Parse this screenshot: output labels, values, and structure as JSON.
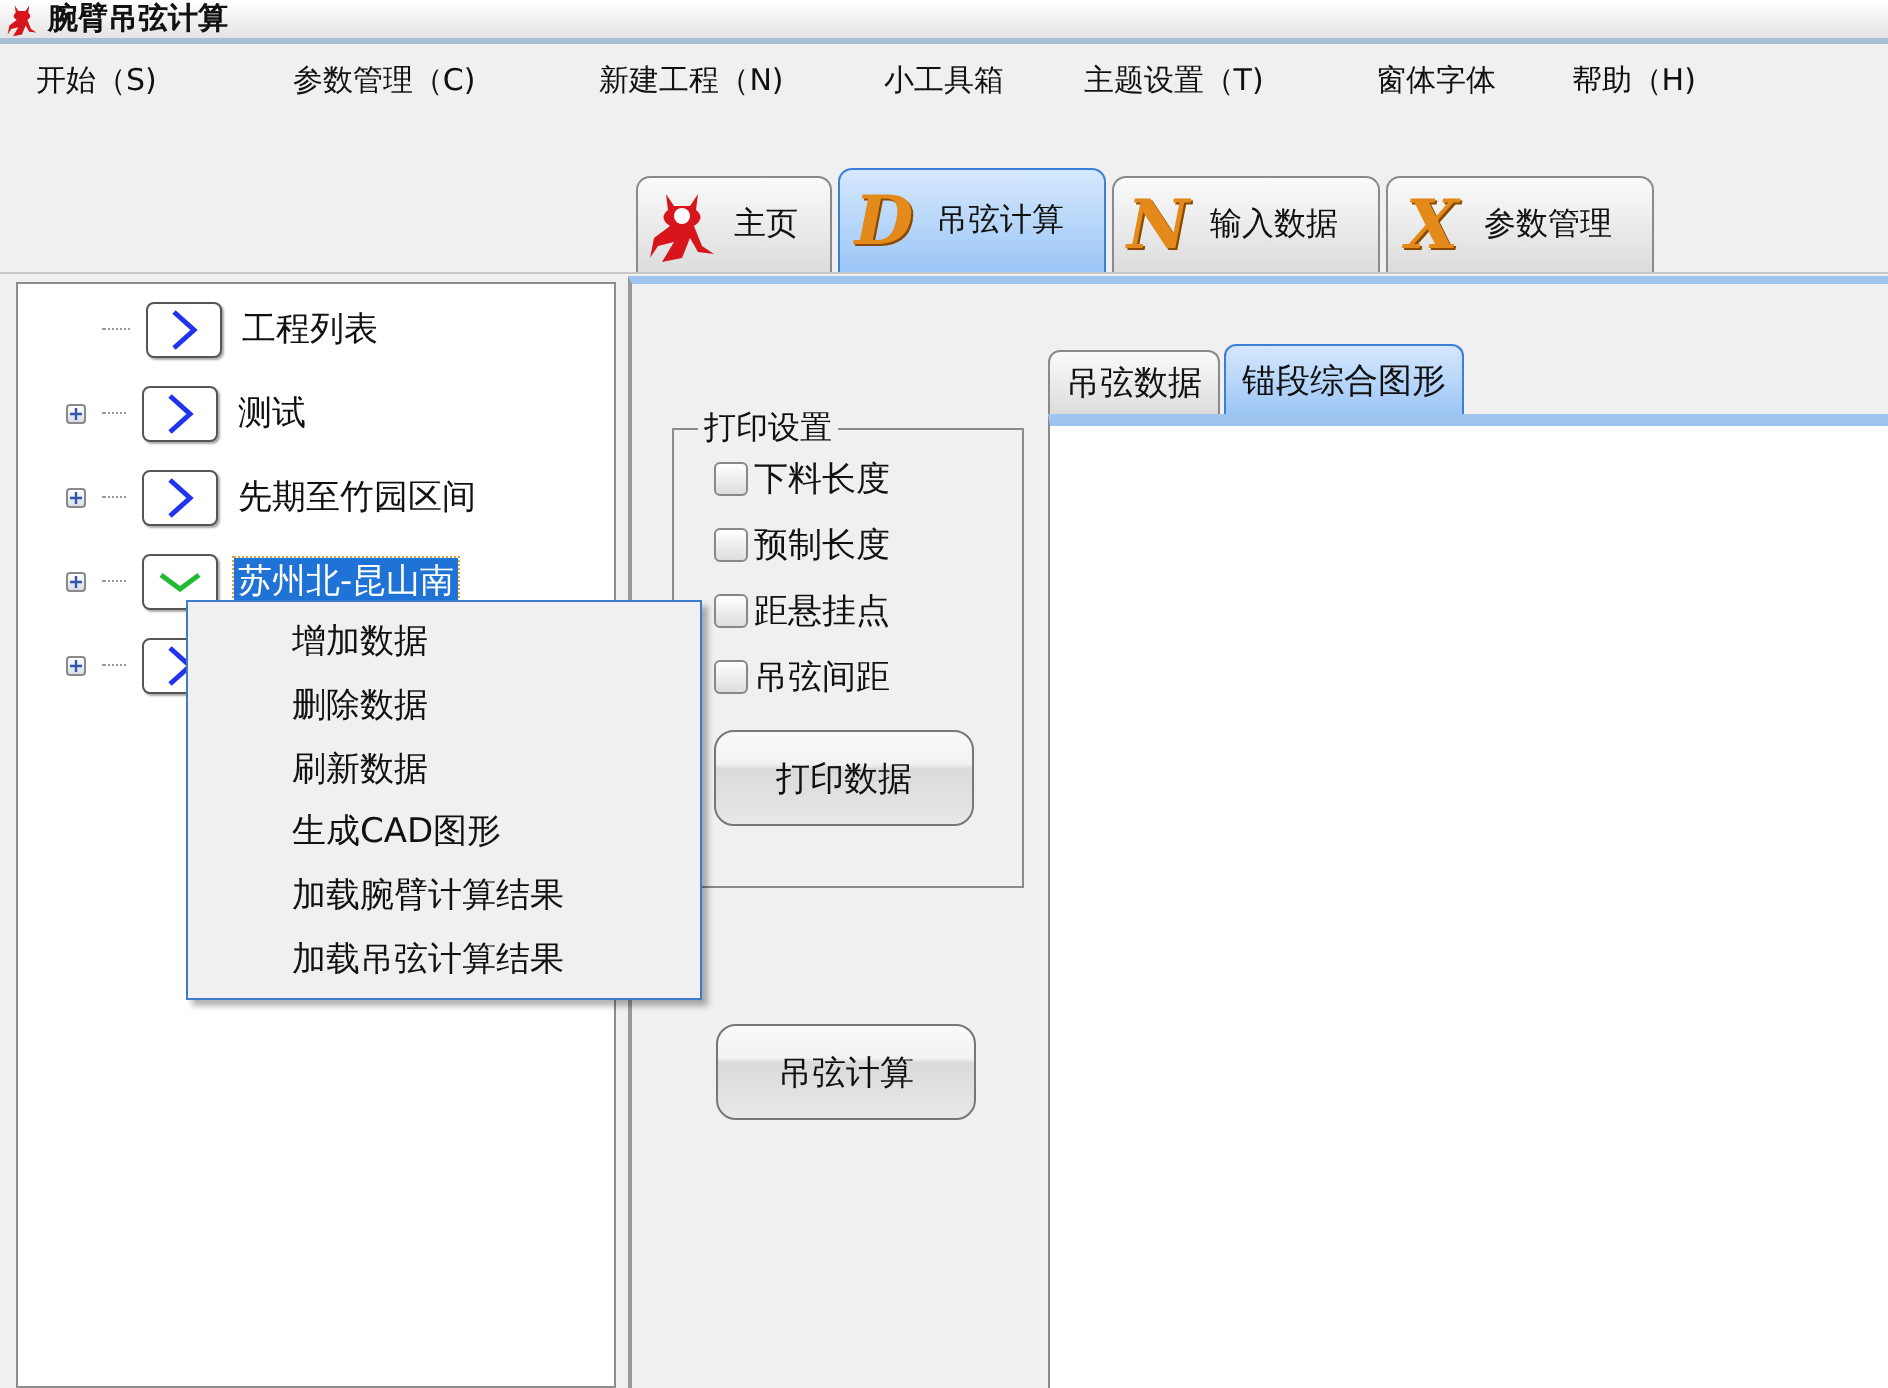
{
  "window": {
    "title": "腕臂吊弦计算"
  },
  "menu": [
    "开始（S)",
    "参数管理（C)",
    "新建工程（N)",
    "小工具箱",
    "主题设置（T)",
    "窗体字体",
    "帮助（H)"
  ],
  "tabs": [
    {
      "label": "主页",
      "kind": "figure",
      "selected": false
    },
    {
      "label": "吊弦计算",
      "kind": "letter",
      "letter": "D",
      "selected": true
    },
    {
      "label": "输入数据",
      "kind": "letter",
      "letter": "N",
      "selected": false
    },
    {
      "label": "参数管理",
      "kind": "letter",
      "letter": "X",
      "selected": false
    }
  ],
  "tree": [
    {
      "label": "工程列表",
      "expandable": false,
      "expanded": false,
      "selected": false
    },
    {
      "label": "测试",
      "expandable": true,
      "expanded": false,
      "selected": false
    },
    {
      "label": "先期至竹园区间",
      "expandable": true,
      "expanded": false,
      "selected": false
    },
    {
      "label": "苏州北-昆山南",
      "expandable": true,
      "expanded": true,
      "selected": true
    },
    {
      "expandable": true,
      "expanded": false,
      "selected": false
    }
  ],
  "context_menu": [
    "增加数据",
    "删除数据",
    "刷新数据",
    "生成CAD图形",
    "加载腕臂计算结果",
    "加载吊弦计算结果"
  ],
  "print_settings": {
    "title": "打印设置",
    "options": [
      {
        "label": "下料长度",
        "checked": false
      },
      {
        "label": "预制长度",
        "checked": false
      },
      {
        "label": "距悬挂点",
        "checked": false
      },
      {
        "label": "吊弦间距",
        "checked": false
      }
    ],
    "button": "打印数据"
  },
  "calc_button": "吊弦计算",
  "inner_tabs": [
    {
      "label": "吊弦数据",
      "selected": false
    },
    {
      "label": "锚段综合图形",
      "selected": true
    }
  ]
}
